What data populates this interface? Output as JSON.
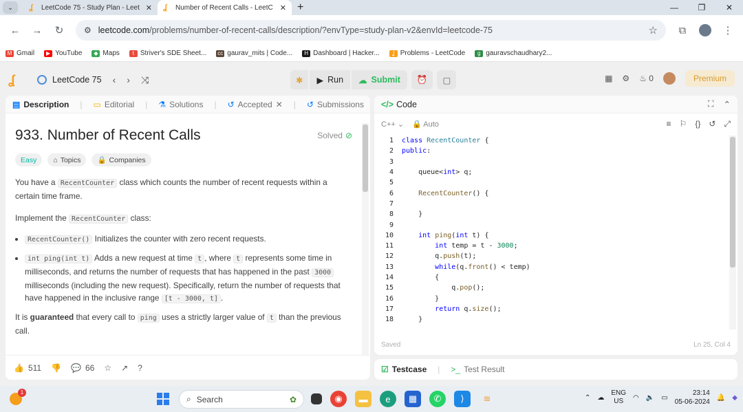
{
  "browser": {
    "tabs": [
      {
        "title": "LeetCode 75 - Study Plan - Leet",
        "active": false
      },
      {
        "title": "Number of Recent Calls - LeetC",
        "active": true
      }
    ],
    "url_host": "leetcode.com",
    "url_path": "/problems/number-of-recent-calls/description/?envType=study-plan-v2&envId=leetcode-75",
    "bookmarks": [
      "Gmail",
      "YouTube",
      "Maps",
      "Striver's SDE Sheet...",
      "gaurav_mits | Code...",
      "Dashboard | Hacker...",
      "Problems - LeetCode",
      "gauravschaudhary2..."
    ]
  },
  "topbar": {
    "study_plan": "LeetCode 75",
    "run_label": "Run",
    "submit_label": "Submit",
    "streak": "0",
    "premium_label": "Premium"
  },
  "left_panel": {
    "tabs": [
      "Description",
      "Editorial",
      "Solutions",
      "Accepted",
      "Submissions"
    ],
    "title": "933. Number of Recent Calls",
    "solved_label": "Solved",
    "difficulty": "Easy",
    "chips": [
      "Topics",
      "Companies"
    ],
    "p1_a": "You have a ",
    "p1_code": "RecentCounter",
    "p1_b": " class which counts the number of recent requests within a certain time frame.",
    "p2_a": "Implement the ",
    "p2_code": "RecentCounter",
    "p2_b": " class:",
    "b1_code": "RecentCounter()",
    "b1_text": " Initializes the counter with zero recent requests.",
    "b2_code": "int ping(int t)",
    "b2_a": " Adds a new request at time ",
    "b2_t": "t",
    "b2_b": ", where ",
    "b2_t2": "t",
    "b2_c": " represents some time in milliseconds, and returns the number of requests that has happened in the past ",
    "b2_num": "3000",
    "b2_d": " milliseconds (including the new request). Specifically, return the number of requests that have happened in the inclusive range ",
    "b2_range": "[t - 3000, t]",
    "b2_e": ".",
    "p3_a": "It is ",
    "p3_bold": "guaranteed",
    "p3_b": " that every call to ",
    "p3_code": "ping",
    "p3_c": " uses a strictly larger value of ",
    "p3_t": "t",
    "p3_d": " than the previous call.",
    "likes": "511",
    "comments": "66"
  },
  "code_panel": {
    "title": "Code",
    "language": "C++",
    "mode": "Auto",
    "status_left": "Saved",
    "status_right": "Ln 25, Col 4"
  },
  "code_lines": [
    {
      "n": "1"
    },
    {
      "n": "2"
    },
    {
      "n": "3"
    },
    {
      "n": "4"
    },
    {
      "n": "5"
    },
    {
      "n": "6"
    },
    {
      "n": "7"
    },
    {
      "n": "8"
    },
    {
      "n": "9"
    },
    {
      "n": "10"
    },
    {
      "n": "11"
    },
    {
      "n": "12"
    },
    {
      "n": "13"
    },
    {
      "n": "14"
    },
    {
      "n": "15"
    },
    {
      "n": "16"
    },
    {
      "n": "17"
    },
    {
      "n": "18"
    }
  ],
  "test_panel": {
    "testcase": "Testcase",
    "result": "Test Result"
  },
  "taskbar": {
    "notification_count": "1",
    "search_placeholder": "Search",
    "lang_top": "ENG",
    "lang_bottom": "US",
    "time": "23:14",
    "date": "05-06-2024"
  }
}
